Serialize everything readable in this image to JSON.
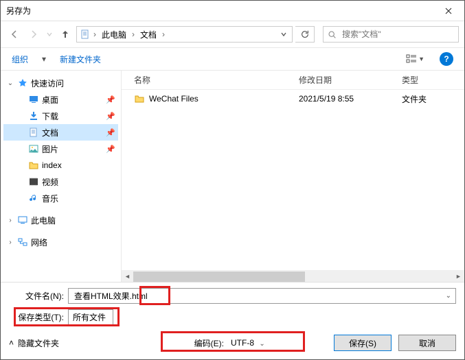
{
  "window": {
    "title": "另存为"
  },
  "path": {
    "root": "此电脑",
    "folder": "文档"
  },
  "search": {
    "placeholder": "搜索\"文档\""
  },
  "toolbar": {
    "organize": "组织",
    "newfolder": "新建文件夹"
  },
  "tree": {
    "quickaccess": "快速访问",
    "desktop": "桌面",
    "downloads": "下载",
    "documents": "文档",
    "pictures": "图片",
    "index": "index",
    "videos": "视频",
    "music": "音乐",
    "thispc": "此电脑",
    "network": "网络"
  },
  "columns": {
    "name": "名称",
    "date": "修改日期",
    "type": "类型"
  },
  "rows": [
    {
      "name": "WeChat Files",
      "date": "2021/5/19 8:55",
      "type": "文件夹"
    }
  ],
  "form": {
    "filename_label": "文件名(N):",
    "filename_value": "查看HTML效果.html",
    "filetype_label": "保存类型(T):",
    "filetype_value": "所有文件",
    "encoding_label": "编码(E):",
    "encoding_value": "UTF-8",
    "hidefolders": "隐藏文件夹",
    "save": "保存(S)",
    "cancel": "取消"
  }
}
